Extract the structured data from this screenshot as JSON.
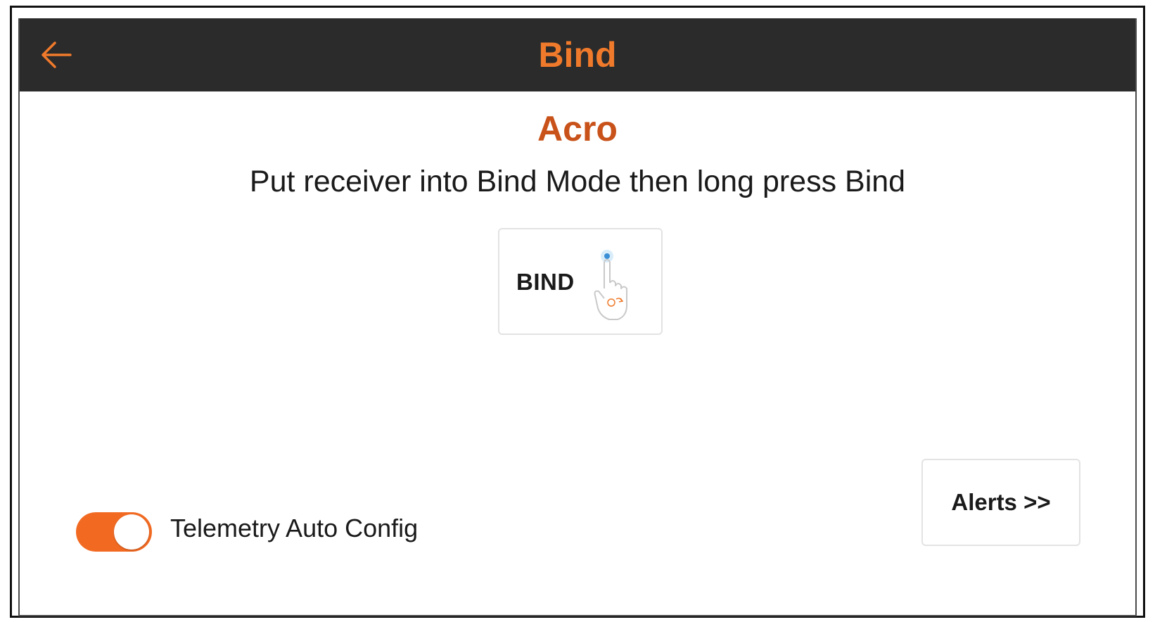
{
  "header": {
    "title": "Bind",
    "back_icon": "arrow-left-icon",
    "title_color": "#f07a2b",
    "background": "#2b2b2b"
  },
  "main": {
    "model_name": "Acro",
    "model_name_color": "#c8521a",
    "instruction": "Put receiver into Bind Mode then long press Bind",
    "bind_button": {
      "label": "BIND",
      "icon": "hand-press-icon"
    }
  },
  "footer": {
    "telemetry_toggle": {
      "label": "Telemetry Auto Config",
      "state": "on",
      "color": "#f26a22"
    },
    "alerts_button": {
      "label": "Alerts >>"
    }
  }
}
